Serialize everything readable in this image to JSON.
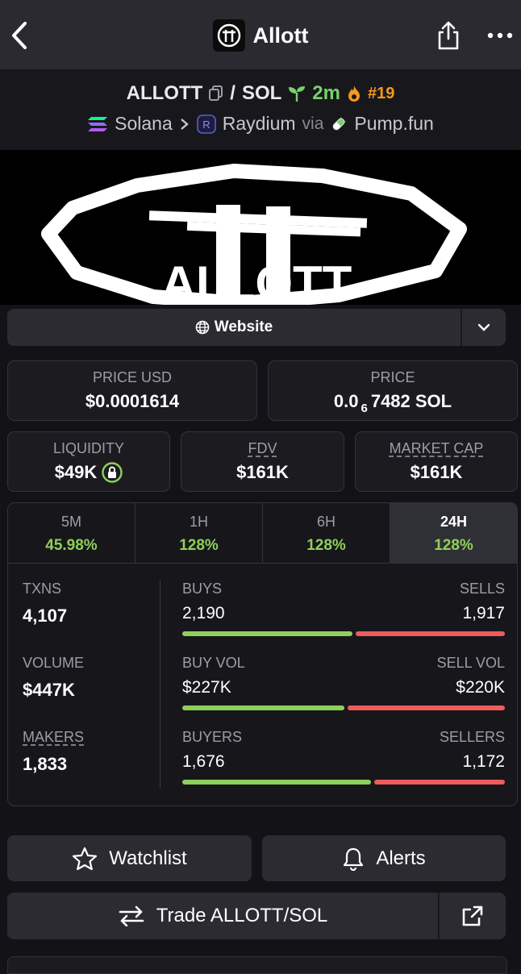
{
  "nav": {
    "title": "Allott"
  },
  "pair": {
    "base": "ALLOTT",
    "separator": "/",
    "quote": "SOL",
    "age": "2m",
    "rank": "#19",
    "chain": "Solana",
    "dex": "Raydium",
    "via": "via",
    "launchpad": "Pump.fun"
  },
  "banner": {
    "logo_text": "ALLOTT"
  },
  "links": {
    "website_label": "Website"
  },
  "prices": {
    "price_usd_label": "PRICE USD",
    "price_usd": "$0.0001614",
    "price_label": "PRICE",
    "price_prefix": "0.0",
    "price_sub": "6",
    "price_suffix": "7482 SOL"
  },
  "metrics": {
    "liquidity_label": "LIQUIDITY",
    "liquidity": "$49K",
    "fdv_label": "FDV",
    "fdv": "$161K",
    "mcap_label": "MARKET CAP",
    "mcap": "$161K"
  },
  "timeframes": [
    {
      "label": "5M",
      "change": "45.98%"
    },
    {
      "label": "1H",
      "change": "128%"
    },
    {
      "label": "6H",
      "change": "128%"
    },
    {
      "label": "24H",
      "change": "128%"
    }
  ],
  "stats": {
    "txns_label": "TXNS",
    "txns": "4,107",
    "volume_label": "VOLUME",
    "volume": "$447K",
    "makers_label": "MAKERS",
    "makers": "1,833",
    "buys_label": "BUYS",
    "buys": "2,190",
    "sells_label": "SELLS",
    "sells": "1,917",
    "buys_ratio": 0.533,
    "buyvol_label": "BUY VOL",
    "buyvol": "$227K",
    "sellvol_label": "SELL VOL",
    "sellvol": "$220K",
    "buyvol_ratio": 0.508,
    "buyers_label": "BUYERS",
    "buyers": "1,676",
    "sellers_label": "SELLERS",
    "sellers": "1,172",
    "buyers_ratio": 0.589
  },
  "actions": {
    "watchlist": "Watchlist",
    "alerts": "Alerts",
    "trade": "Trade ALLOTT/SOL"
  },
  "colors": {
    "buy": "#8fcf5c",
    "sell": "#ef5b5b",
    "accent_orange": "#f39a1d"
  }
}
